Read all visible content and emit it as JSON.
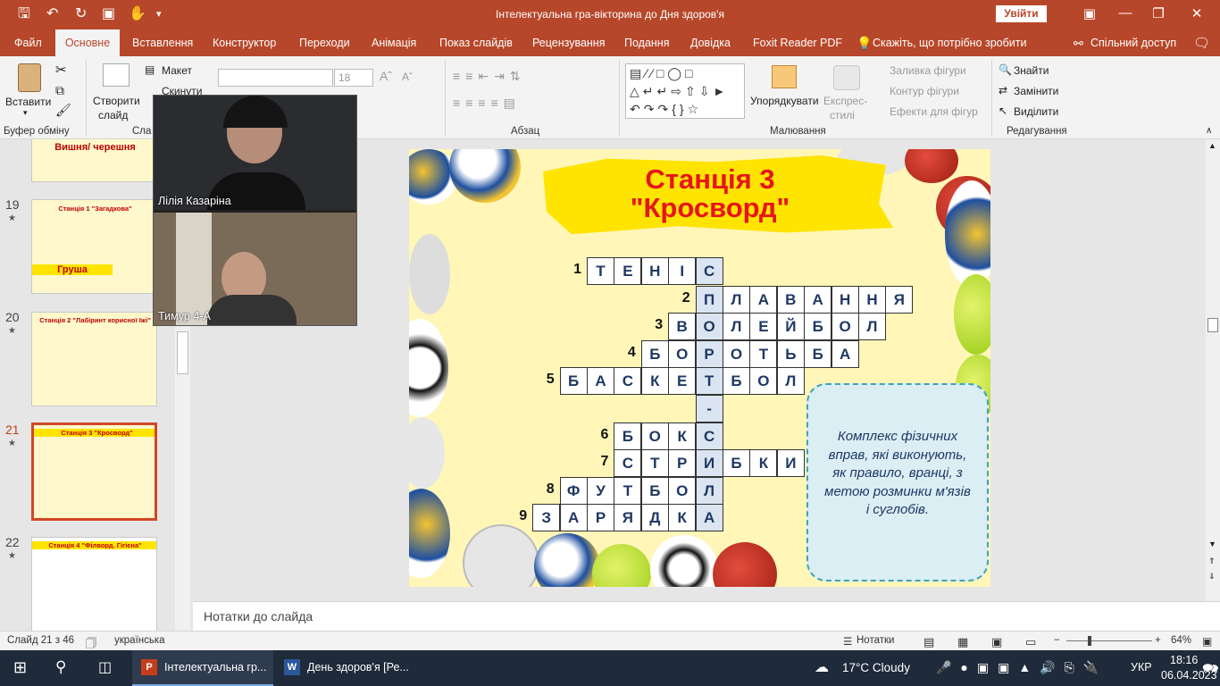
{
  "window": {
    "title": "Інтелектуальна гра-вікторина до Дня здоров'я",
    "login": "Увійти"
  },
  "tabs": [
    {
      "label": "Файл"
    },
    {
      "label": "Основне"
    },
    {
      "label": "Вставлення"
    },
    {
      "label": "Конструктор"
    },
    {
      "label": "Переходи"
    },
    {
      "label": "Анімація"
    },
    {
      "label": "Показ слайдів"
    },
    {
      "label": "Рецензування"
    },
    {
      "label": "Подання"
    },
    {
      "label": "Довідка"
    },
    {
      "label": "Foxit Reader PDF"
    }
  ],
  "tell_me": "Скажіть, що потрібно зробити",
  "share": "Спільний доступ",
  "ribbon": {
    "paste": "Вставити",
    "clipboard": "Буфер обміну",
    "new_slide_1": "Створити",
    "new_slide_2": "слайд",
    "layout": "Макет",
    "reset": "Скинути",
    "slides_group": "Сла",
    "font_size": "18",
    "paragraph": "Абзац",
    "arrange": "Упорядкувати",
    "quick_styles_1": "Експрес-",
    "quick_styles_2": "стилі",
    "fill": "Заливка фігури",
    "outline": "Контур фігури",
    "effects": "Ефекти для фігур",
    "drawing": "Малювання",
    "find": "Знайти",
    "replace": "Замінити",
    "select": "Виділити",
    "editing": "Редагування"
  },
  "thumbnails": [
    {
      "title": "Вишня/ черешня"
    },
    {
      "num": "19",
      "title": "Станція 1 \"Загадкова\"",
      "word": "Груша"
    },
    {
      "num": "20",
      "title": "Станція 2 \"Лабіринт корисної їжі\""
    },
    {
      "num": "21",
      "title": "Станція 3 \"Кросворд\""
    },
    {
      "num": "22",
      "title": "Станція 4 \"Філворд. Гігієна\""
    }
  ],
  "video": {
    "participant1": "Лілія Казаріна",
    "participant2": "Тимур 4-А"
  },
  "slide": {
    "title_line1": "Станція 3",
    "title_line2": "\"Кросворд\"",
    "clue": "Комплекс фізичних вправ, які виконують, як правило, вранці, з метою розминки м'язів і суглобів.",
    "rows": [
      {
        "num": "1",
        "start": 0,
        "letters": [
          "Т",
          "Е",
          "Н",
          "І",
          "С"
        ]
      },
      {
        "num": "2",
        "start": 4,
        "letters": [
          "П",
          "Л",
          "А",
          "В",
          "А",
          "Н",
          "Н",
          "Я"
        ]
      },
      {
        "num": "3",
        "start": 3,
        "letters": [
          "В",
          "О",
          "Л",
          "Е",
          "Й",
          "Б",
          "О",
          "Л"
        ]
      },
      {
        "num": "4",
        "start": 2,
        "letters": [
          "Б",
          "О",
          "Р",
          "О",
          "Т",
          "Ь",
          "Б",
          "А"
        ]
      },
      {
        "num": "5",
        "start": -1,
        "letters": [
          "Б",
          "А",
          "С",
          "К",
          "Е",
          "Т",
          "Б",
          "О",
          "Л"
        ]
      },
      {
        "num": "",
        "start": 4,
        "letters": [
          "-"
        ]
      },
      {
        "num": "6",
        "start": 1,
        "letters": [
          "Б",
          "О",
          "К",
          "С"
        ]
      },
      {
        "num": "7",
        "start": 1,
        "letters": [
          "С",
          "Т",
          "Р",
          "И",
          "Б",
          "К",
          "И"
        ]
      },
      {
        "num": "8",
        "start": -1,
        "letters": [
          "Ф",
          "У",
          "Т",
          "Б",
          "О",
          "Л"
        ]
      },
      {
        "num": "9",
        "start": -2,
        "letters": [
          "З",
          "А",
          "Р",
          "Я",
          "Д",
          "К",
          "А"
        ]
      }
    ]
  },
  "notes": "Нотатки до слайда",
  "status": {
    "slide": "Слайд 21 з 46",
    "language": "українська",
    "notes": "Нотатки",
    "zoom": "64%"
  },
  "taskbar": {
    "app1": "Інтелектуальна гр...",
    "app2": "День здоров'я [Ре...",
    "weather": "17°C  Cloudy",
    "lang": "УКР",
    "time": "18:16",
    "date": "06.04.2023"
  },
  "colors": {
    "accent": "#b7472a",
    "title_red": "#e8141c",
    "key_column": "#dbe5f1"
  }
}
